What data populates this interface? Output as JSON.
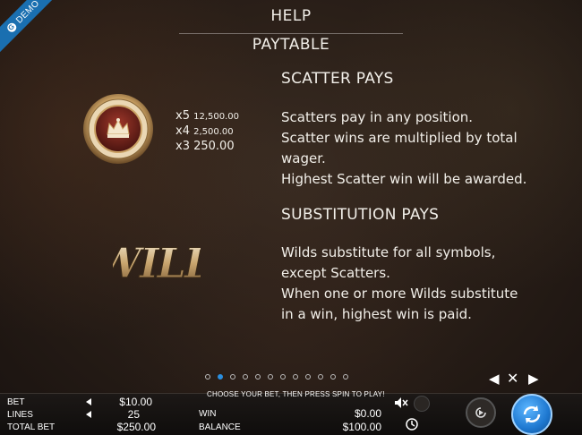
{
  "demo_label": "DEMO",
  "header": {
    "title": "HELP",
    "subtitle": "PAYTABLE"
  },
  "scatter": {
    "heading": "SCATTER PAYS",
    "pays": [
      {
        "count": "x5",
        "amount": "12,500.00"
      },
      {
        "count": "x4",
        "amount": "2,500.00"
      },
      {
        "count": "x3",
        "amount": "250.00"
      }
    ],
    "lines": [
      "Scatters pay in any position.",
      "Scatter wins are multiplied by total",
      "wager.",
      "Highest Scatter win will be awarded."
    ]
  },
  "substitution": {
    "heading": "SUBSTITUTION PAYS",
    "symbol_text": "WILD",
    "lines": [
      "Wilds substitute for all symbols,",
      "except Scatters.",
      "When one or more Wilds substitute",
      "in a win, highest win is paid."
    ]
  },
  "pagination": {
    "total": 12,
    "active_index": 1
  },
  "nav": {
    "prev": "◀",
    "close": "✕",
    "next": "▶"
  },
  "bottom_bar": {
    "message": "CHOOSE YOUR BET, THEN PRESS SPIN TO PLAY!",
    "bet_label": "BET",
    "bet_value": "$10.00",
    "lines_label": "LINES",
    "lines_value": "25",
    "total_bet_label": "TOTAL BET",
    "total_bet_value": "$250.00",
    "win_label": "WIN",
    "win_value": "$0.00",
    "balance_label": "BALANCE",
    "balance_value": "$100.00"
  },
  "colors": {
    "accent": "#2b8fe0",
    "demo": "#1a6fb0",
    "gold": "#c9a063"
  }
}
